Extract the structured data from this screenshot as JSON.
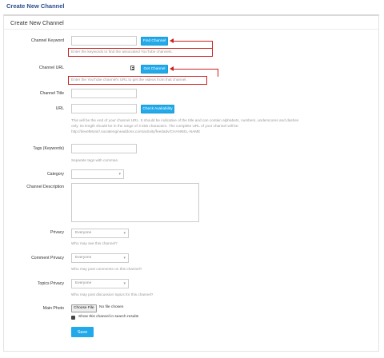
{
  "page": {
    "title": "Create New Channel"
  },
  "panel": {
    "title": "Create New Channel"
  },
  "fields": {
    "keyword": {
      "label": "Channel Keyword",
      "value": "",
      "button": "Find Channel",
      "help": "Enter the keywords to find the associated YouTube channels."
    },
    "url": {
      "label": "Channel URL",
      "value": "",
      "button": "Get Channel",
      "help": "Enter the YouTube channel's URL to get the videos from that channel."
    },
    "title": {
      "label": "Channel Title",
      "value": ""
    },
    "url2": {
      "label": "URL",
      "value": "",
      "button": "Check Availability",
      "help1": "This will be the end of your channel URL. It should be indicative of the title and can contain alphabets, numbers, underscores and dashes",
      "help2": "only. Its length should be in the range of 3-255 characters. The complete URL of your channel will be:",
      "help3": "http://develMonir/.socialengineaddons.com/activity/feedadv/CHANNEL-NAME"
    },
    "tags": {
      "label": "Tags (Keywords)",
      "value": "",
      "help": "Separate tags with commas."
    },
    "category": {
      "label": "Category",
      "value": ""
    },
    "description": {
      "label": "Channel Description",
      "value": ""
    },
    "privacy": {
      "label": "Privacy",
      "value": "Everyone",
      "help": "Who may see this channel?"
    },
    "comment_privacy": {
      "label": "Comment Privacy",
      "value": "Everyone",
      "help": "Who may post comments on this channel?"
    },
    "topics_privacy": {
      "label": "Topics Privacy",
      "value": "Everyone",
      "help": "Who may post discussion topics for this channel?"
    },
    "photo": {
      "label": "Main Photo",
      "button": "Choose File",
      "status": "No file chosen"
    },
    "search": {
      "label": "Show this channel in search results",
      "checked": true
    }
  },
  "actions": {
    "save": "Save"
  },
  "colors": {
    "accent": "#22a9e9",
    "annotation": "#cc1f1f",
    "title": "#2a4e8c"
  }
}
